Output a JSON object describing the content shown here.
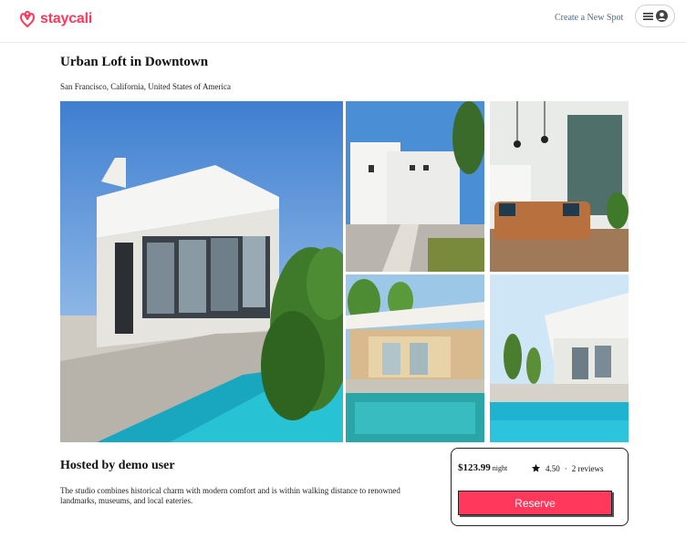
{
  "navbar": {
    "logo_text": "staycali",
    "create_spot_label": "Create a New Spot"
  },
  "spot": {
    "name": "Urban Loft in Downtown",
    "location": "San Francisco, California, United States of America",
    "host_heading": "Hosted by demo user",
    "description": "The studio combines historical charm with modern comfort and is within walking distance to renowned landmarks, museums, and local eateries."
  },
  "booking": {
    "price": "$123.99",
    "per_label": "night",
    "rating": "4.50",
    "separator": "·",
    "reviews": "2 reviews",
    "reserve_label": "Reserve"
  },
  "icons": {
    "logo": "airbnb-style-logo-icon",
    "menu": "hamburger-icon",
    "profile": "user-circle-icon",
    "rating": "star-icon"
  },
  "colors": {
    "brand": "#ff385c",
    "link": "#4a6b8a",
    "pool": "#29b6c6"
  }
}
